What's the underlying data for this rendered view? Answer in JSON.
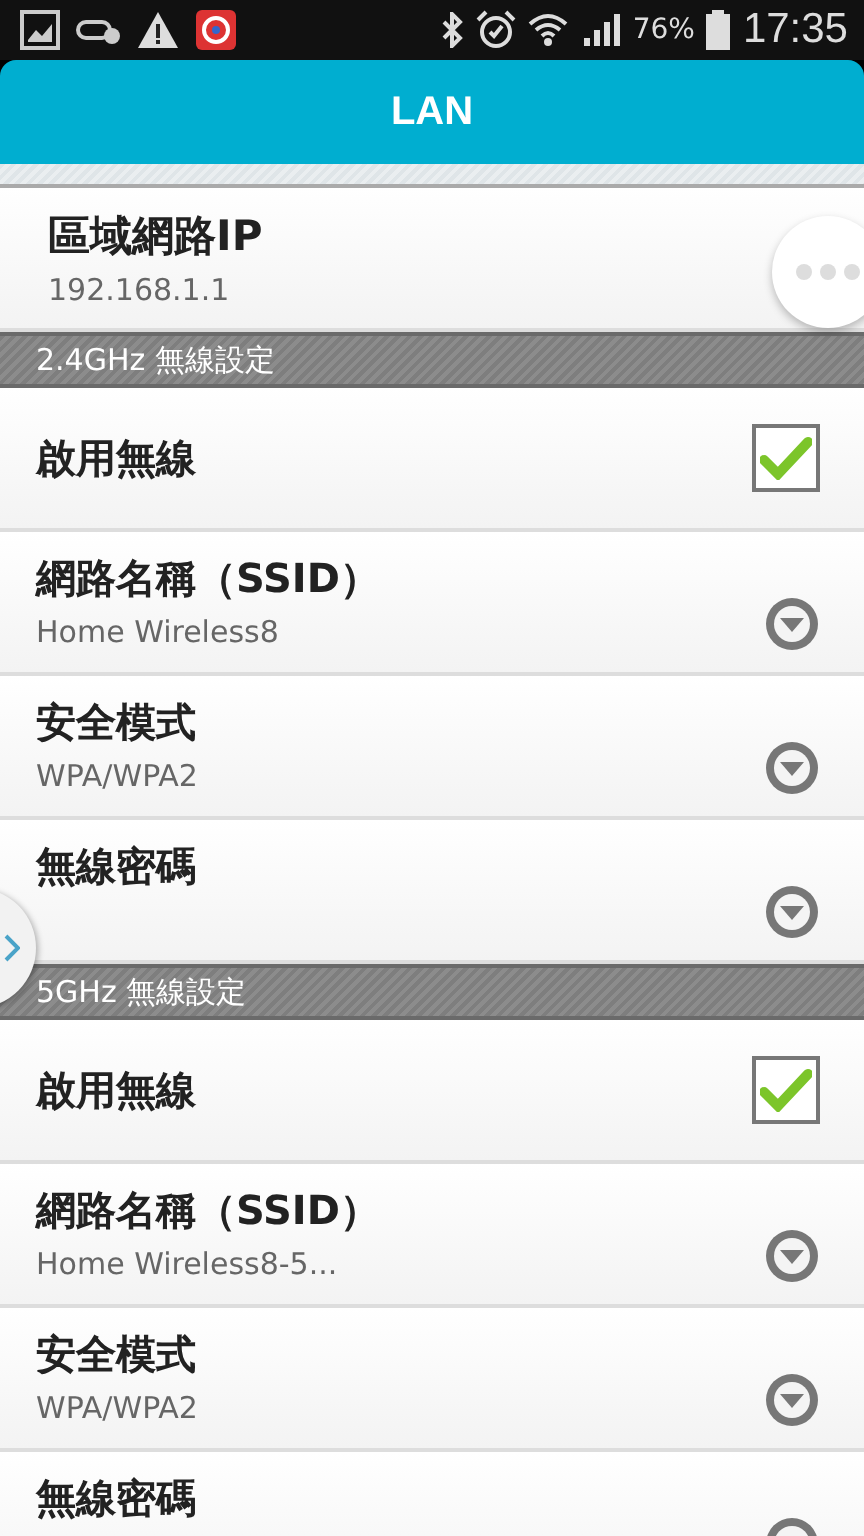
{
  "status_bar": {
    "battery": "76%",
    "time": "17:35"
  },
  "header": {
    "title": "LAN"
  },
  "lan_ip": {
    "label": "區域網路IP",
    "value": "192.168.1.1"
  },
  "sections": [
    {
      "title": "2.4GHz 無線設定",
      "items": [
        {
          "kind": "checkbox",
          "label": "啟用無線",
          "checked": true
        },
        {
          "kind": "dropdown",
          "label": "網路名稱（SSID）",
          "value": "Home Wireless8"
        },
        {
          "kind": "dropdown",
          "label": "安全模式",
          "value": "WPA/WPA2"
        },
        {
          "kind": "dropdown",
          "label": "無線密碼"
        }
      ]
    },
    {
      "title": "5GHz 無線設定",
      "items": [
        {
          "kind": "checkbox",
          "label": "啟用無線",
          "checked": true
        },
        {
          "kind": "dropdown",
          "label": "網路名稱（SSID）",
          "value": "Home Wireless8-5..."
        },
        {
          "kind": "dropdown",
          "label": "安全模式",
          "value": "WPA/WPA2"
        },
        {
          "kind": "dropdown",
          "label": "無線密碼"
        }
      ]
    }
  ]
}
